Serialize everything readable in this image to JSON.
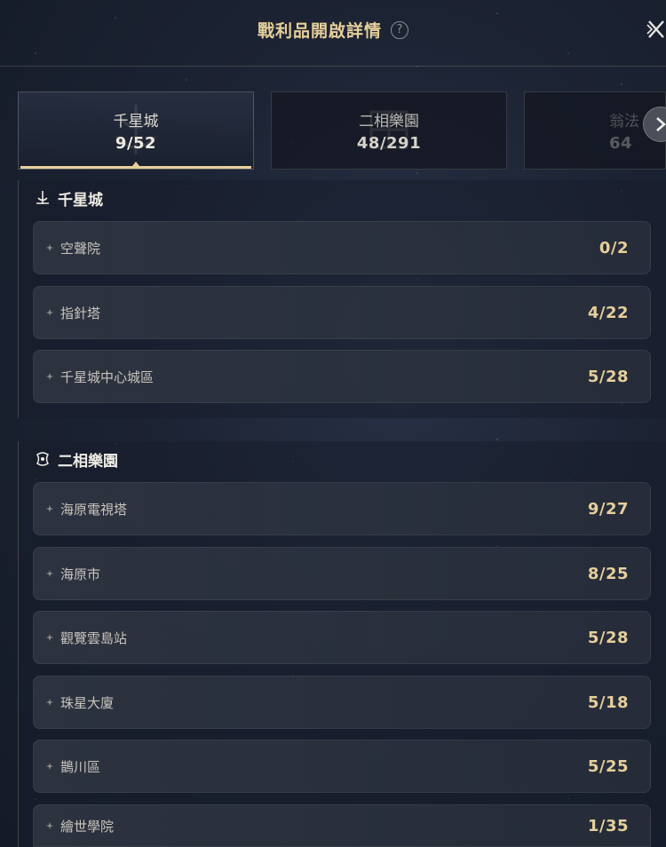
{
  "header": {
    "title": "戰利品開啟詳情",
    "help_icon": "?"
  },
  "tabs": [
    {
      "name": "千星城",
      "count": "9/52",
      "active": true
    },
    {
      "name": "二相樂園",
      "count": "48/291",
      "active": false
    },
    {
      "name": "翁法",
      "count": "64",
      "active": false
    }
  ],
  "sections": [
    {
      "title": "千星城",
      "icon": "city-emblem-icon",
      "rows": [
        {
          "name": "空聲院",
          "count": "0/2"
        },
        {
          "name": "指針塔",
          "count": "4/22"
        },
        {
          "name": "千星城中心城區",
          "count": "5/28"
        }
      ]
    },
    {
      "title": "二相樂園",
      "icon": "park-emblem-icon",
      "rows": [
        {
          "name": "海原電視塔",
          "count": "9/27"
        },
        {
          "name": "海原市",
          "count": "8/25"
        },
        {
          "name": "觀覽雲島站",
          "count": "5/28"
        },
        {
          "name": "珠星大廈",
          "count": "5/18"
        },
        {
          "name": "鵲川區",
          "count": "5/25"
        },
        {
          "name": "繪世學院",
          "count": "1/35"
        }
      ]
    }
  ],
  "colors": {
    "accent_gold": "#e6cf9a",
    "background": "#1c2333",
    "row_bg": "#343a46"
  }
}
